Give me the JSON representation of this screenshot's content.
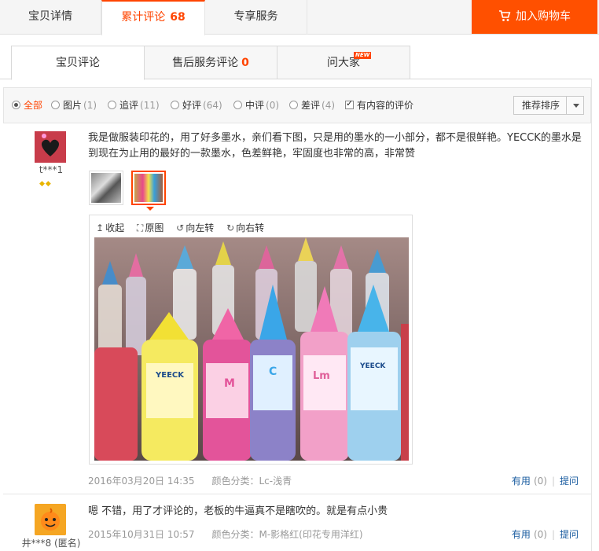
{
  "top_tabs": {
    "details": "宝贝详情",
    "reviews_label": "累计评论",
    "reviews_count": "68",
    "service": "专享服务",
    "cart": "加入购物车"
  },
  "sub_tabs": {
    "item_reviews": "宝贝评论",
    "after_sales_label": "售后服务评论",
    "after_sales_count": "0",
    "ask": "问大家",
    "new_badge": "NEW"
  },
  "filter": {
    "all": "全部",
    "pictures": "图片",
    "pictures_n": "(1)",
    "followup": "追评",
    "followup_n": "(11)",
    "good": "好评",
    "good_n": "(64)",
    "neutral": "中评",
    "neutral_n": "(0)",
    "bad": "差评",
    "bad_n": "(4)",
    "has_content": "有内容的评价",
    "sort": "推荐排序"
  },
  "reviews": [
    {
      "user": "t***1",
      "text": "我是做服装印花的，用了好多墨水，亲们看下图，只是用的墨水的一小部分，都不是很鲜艳。YECCK的墨水是到现在为止用的最好的一款墨水，色差鲜艳，牢固度也非常的高，非常赞",
      "date": "2016年03月20日 14:35",
      "color": "颜色分类：Lc-浅青",
      "useful": "有用",
      "useful_n": "(0)",
      "reply": "提问"
    },
    {
      "user": "井***8 (匿名)",
      "text": "嗯 不错，用了才评论的，老板的牛逼真不是瞎吹的。就是有点小贵",
      "date": "2015年10月31日 10:57",
      "color": "颜色分类：M-影格红(印花专用洋红)",
      "useful": "有用",
      "useful_n": "(0)",
      "reply": "提问"
    }
  ],
  "viewer": {
    "collapse": "收起",
    "original": "原图",
    "rotate_left": "向左转",
    "rotate_right": "向右转"
  },
  "bottle_labels": [
    "YEECK",
    "M",
    "C",
    "Lm",
    "YEECK"
  ],
  "colors": {
    "accent": "#ff4400",
    "cart": "#ff5000",
    "link": "#1a5ca0"
  }
}
